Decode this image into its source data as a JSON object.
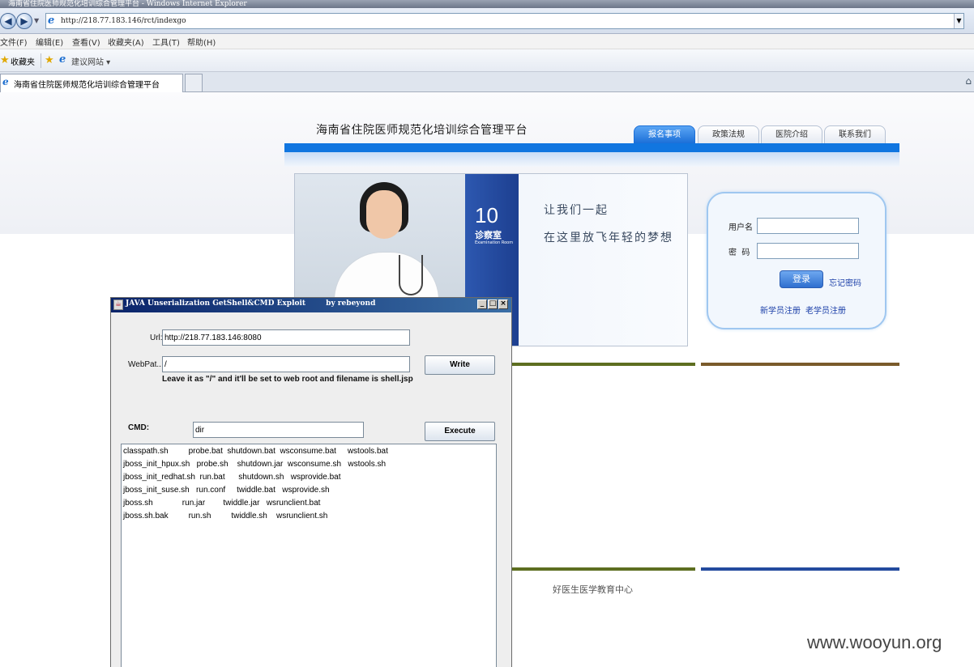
{
  "browser": {
    "window_title": "海南省住院医师规范化培训综合管理平台 - Windows Internet Explorer",
    "address": "http://218.77.183.146/rct/indexgo",
    "menu": [
      "文件(F)",
      "编辑(E)",
      "查看(V)",
      "收藏夹(A)",
      "工具(T)",
      "帮助(H)"
    ],
    "favorites_label": "收藏夹",
    "suggested_sites_label": "建议网站 ▾",
    "tab_title": "海南省住院医师规范化培训综合管理平台"
  },
  "site": {
    "title": "海南省住院医师规范化培训综合管理平台",
    "tabs": [
      "报名事项",
      "政策法规",
      "医院介绍",
      "联系我们"
    ],
    "banner": {
      "room_number": "10",
      "room_label": "诊察室",
      "room_sublabel": "Examination Room",
      "slogan_line1": "让我们一起",
      "slogan_line2": "在这里放飞年轻的梦想"
    },
    "login": {
      "username_label": "用户名",
      "password_label": "密  码",
      "login_button": "登录",
      "forgot_link": "忘记密码",
      "new_student_link": "新学员注册",
      "old_student_link": "老学员注册"
    },
    "footer_link": "好医生医学教育中心"
  },
  "exploit_window": {
    "title": "JAVA Unserialization GetShell&CMD Exploit        by rebeyond",
    "url_label": "Url:",
    "url_value": "http://218.77.183.146:8080",
    "webpath_label": "WebPat...",
    "webpath_value": "/",
    "write_button": "Write",
    "hint": "Leave it as \"/\" and it'll be set to web root and filename is shell.jsp",
    "cmd_label": "CMD:",
    "cmd_value": "dir",
    "execute_button": "Execute",
    "output_lines": [
      "classpath.sh         probe.bat  shutdown.bat  wsconsume.bat     wstools.bat",
      "jboss_init_hpux.sh   probe.sh    shutdown.jar  wsconsume.sh   wstools.sh",
      "jboss_init_redhat.sh  run.bat      shutdown.sh   wsprovide.bat",
      "jboss_init_suse.sh   run.conf     twiddle.bat   wsprovide.sh",
      "jboss.sh             run.jar        twiddle.jar   wsrunclient.bat",
      "jboss.sh.bak         run.sh         twiddle.sh    wsrunclient.sh"
    ]
  },
  "watermark": "www.wooyun.org"
}
